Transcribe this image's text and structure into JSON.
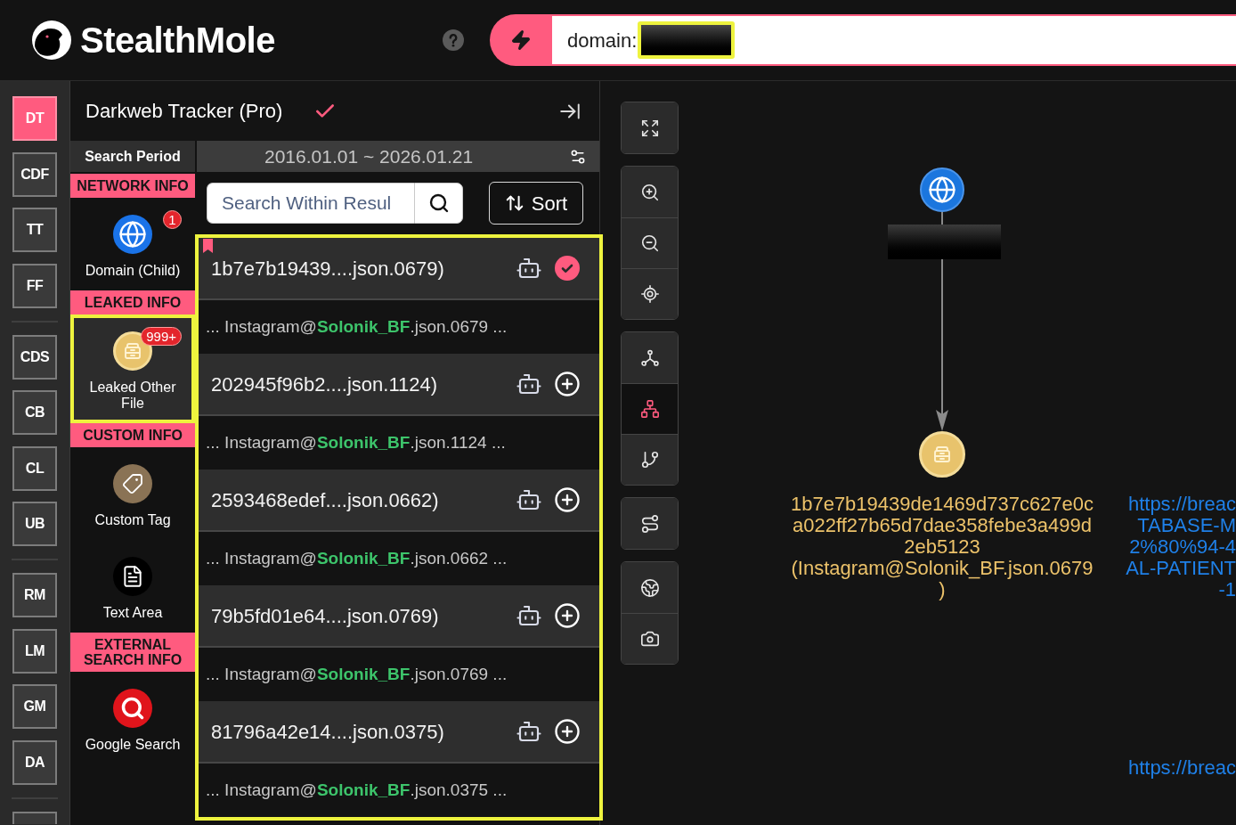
{
  "header": {
    "logo_text": "StealthMole",
    "search": {
      "value": "domain:",
      "query_redacted": true,
      "highlighted": true
    }
  },
  "rail": {
    "groups": [
      [
        {
          "label": "DT",
          "selected": true
        },
        {
          "label": "CDF",
          "selected": false
        },
        {
          "label": "TT",
          "selected": false
        },
        {
          "label": "FF",
          "selected": false
        }
      ],
      [
        {
          "label": "CDS",
          "selected": false
        },
        {
          "label": "CB",
          "selected": false
        },
        {
          "label": "CL",
          "selected": false
        },
        {
          "label": "UB",
          "selected": false
        }
      ],
      [
        {
          "label": "RM",
          "selected": false
        },
        {
          "label": "LM",
          "selected": false
        },
        {
          "label": "GM",
          "selected": false
        },
        {
          "label": "DA",
          "selected": false
        }
      ],
      [
        {
          "selected": false
        }
      ]
    ]
  },
  "panel": {
    "title": "Darkweb Tracker (Pro)",
    "search_period": {
      "label": "Search Period",
      "range": "2016.01.01 ~ 2026.01.21"
    },
    "categories": [
      {
        "heading": "NETWORK INFO",
        "items": [
          {
            "kind": "domain",
            "label": "Domain (Child)",
            "badge": "1",
            "selected": false,
            "highlighted": false
          }
        ]
      },
      {
        "heading": "LEAKED INFO",
        "items": [
          {
            "kind": "leaked-file",
            "label": "Leaked Other File",
            "badge": "999+",
            "selected": true,
            "highlighted": true
          }
        ]
      },
      {
        "heading": "CUSTOM INFO",
        "items": [
          {
            "kind": "tag",
            "label": "Custom Tag",
            "selected": false,
            "highlighted": false
          },
          {
            "kind": "text-area",
            "label": "Text Area",
            "selected": false,
            "highlighted": false
          }
        ]
      },
      {
        "heading": "EXTERNAL SEARCH INFO",
        "items": [
          {
            "kind": "google",
            "label": "Google Search",
            "selected": false,
            "highlighted": false
          }
        ]
      }
    ],
    "filter": {
      "placeholder": "Search Within Resul"
    },
    "sort": {
      "label": "Sort"
    },
    "results": {
      "highlighted": true,
      "items": [
        {
          "title": "1b7e7b19439....json.0679)",
          "snippet": "... Instagram@**Solonik_BF**.json.0679 ...",
          "selected": true,
          "added": true
        },
        {
          "title": "202945f96b2....json.1124)",
          "snippet": "... Instagram@**Solonik_BF**.json.1124 ...",
          "selected": false,
          "added": false
        },
        {
          "title": "2593468edef....json.0662)",
          "snippet": "... Instagram@**Solonik_BF**.json.0662 ...",
          "selected": false,
          "added": false
        },
        {
          "title": "79b5fd01e64....json.0769)",
          "snippet": "... Instagram@**Solonik_BF**.json.0769 ...",
          "selected": false,
          "added": false
        },
        {
          "title": "81796a42e14....json.0375)",
          "snippet": "... Instagram@**Solonik_BF**.json.0375 ...",
          "selected": false,
          "added": false
        }
      ]
    }
  },
  "toolbar": {
    "groups": [
      [
        {
          "kind": "fit",
          "selected": false
        }
      ],
      [
        {
          "kind": "zoom-in",
          "selected": false
        },
        {
          "kind": "zoom-out",
          "selected": false
        },
        {
          "kind": "center",
          "selected": false
        }
      ],
      [
        {
          "kind": "network",
          "selected": false
        },
        {
          "kind": "hierarchy",
          "selected": true
        },
        {
          "kind": "branch",
          "selected": false
        }
      ],
      [
        {
          "kind": "path",
          "selected": false
        }
      ],
      [
        {
          "kind": "globe",
          "selected": false
        },
        {
          "kind": "capture",
          "selected": false
        }
      ]
    ]
  },
  "graph": {
    "nodes": [
      {
        "kind": "domain",
        "label_redacted": true
      },
      {
        "kind": "leaked-file",
        "label_lines": [
          "1b7e7b19439de1469d737c627e0c",
          "a022ff27b65d7dae358febe3a499d",
          "2eb5123",
          "(Instagram@Solonik_BF.json.0679",
          ")"
        ]
      }
    ],
    "url_labels": [
      {
        "lines": [
          "https://breac",
          "TABASE-M",
          "2%80%94-4",
          "AL-PATIENT",
          "-1"
        ]
      },
      {
        "lines": [
          "https://breac"
        ]
      }
    ]
  }
}
